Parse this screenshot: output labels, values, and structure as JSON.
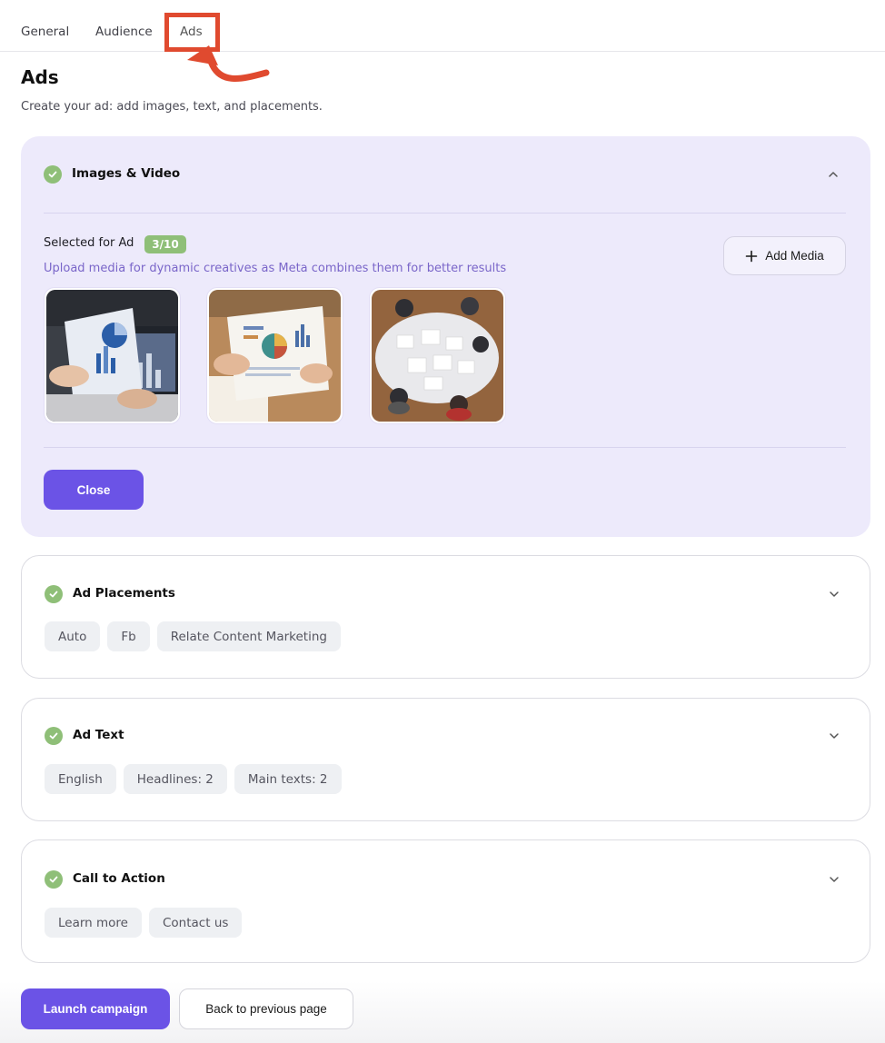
{
  "tabs": [
    {
      "label": "General"
    },
    {
      "label": "Audience"
    },
    {
      "label": "Ads"
    }
  ],
  "active_tab": "Ads",
  "page": {
    "title": "Ads",
    "subtitle": "Create your ad: add images, text, and placements."
  },
  "images_section": {
    "title": "Images & Video",
    "selected_label": "Selected for Ad",
    "count": "3/10",
    "hint": "Upload media for dynamic creatives as Meta combines them for better results",
    "add_media_label": "Add Media",
    "close_label": "Close",
    "media": [
      {
        "subject": "hands with charts and laptop"
      },
      {
        "subject": "hands holding infographic report"
      },
      {
        "subject": "team meeting at table from above"
      }
    ]
  },
  "placements_section": {
    "title": "Ad Placements",
    "chips": [
      "Auto",
      "Fb",
      "Relate Content Marketing"
    ]
  },
  "text_section": {
    "title": "Ad Text",
    "chips": [
      "English",
      "Headlines: 2",
      "Main texts: 2"
    ]
  },
  "cta_section": {
    "title": "Call to Action",
    "chips": [
      "Learn more",
      "Contact us"
    ]
  },
  "footer": {
    "launch_label": "Launch campaign",
    "back_label": "Back to previous page"
  },
  "colors": {
    "accent": "#6b53e6",
    "success": "#8fbf78",
    "annotation": "#e04a2f",
    "panel": "#edeafb"
  },
  "icons": [
    "check-icon",
    "chevron-up-icon",
    "chevron-down-icon",
    "plus-icon",
    "annotation-arrow-icon"
  ]
}
